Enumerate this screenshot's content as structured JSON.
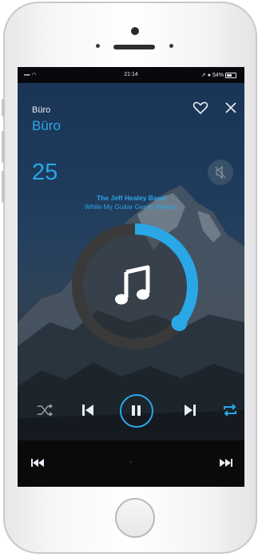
{
  "status_bar": {
    "time": "21:14",
    "battery": "54%"
  },
  "header": {
    "room_small": "Büro",
    "room_large": "Büro"
  },
  "volume": {
    "value": "25"
  },
  "now_playing": {
    "artist": "The Jeff Healey Band",
    "title": "While My Guitar Gently Weeps"
  },
  "progress": {
    "fraction": 0.36
  },
  "icons": [
    "heart-icon",
    "close-icon",
    "mute-icon",
    "music-note-icon",
    "shuffle-icon",
    "previous-icon",
    "pause-icon",
    "next-icon",
    "repeat-icon",
    "rewind-icon",
    "fast-forward-icon"
  ],
  "bottom_bar": {
    "center": "-"
  },
  "colors": {
    "accent": "#2aa7e6",
    "background": "#0c1116",
    "ring": "#3a3a3a"
  }
}
